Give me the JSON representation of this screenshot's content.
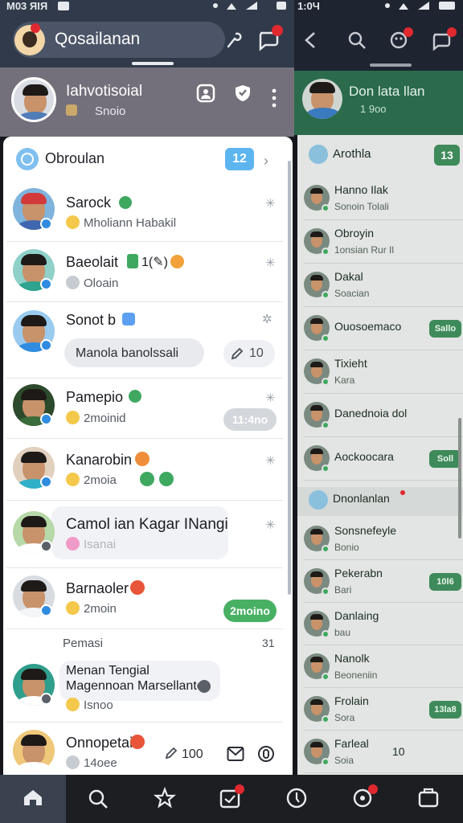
{
  "status_left": {
    "time": "M03 ЯІЯ"
  },
  "status_right": {
    "time": "1:0Ч"
  },
  "left_header": {
    "search_label": "Qosailanan"
  },
  "profile": {
    "name": "Iahvotisoial",
    "status": "Snoio"
  },
  "section": {
    "title": "Obroulan",
    "count": "12"
  },
  "chats": [
    {
      "name": "Sarock",
      "preview": "Mholiann Habakil"
    },
    {
      "name": "Baeolait",
      "name_suffix": "1(✎)",
      "preview": "Oloain"
    },
    {
      "name": "Sonot b",
      "chip": "Manola banolssali",
      "count": "10"
    },
    {
      "name": "Pamepio",
      "preview": "2moinid",
      "badge": "11:4no"
    },
    {
      "name": "Kanarobin",
      "preview": "2moia"
    },
    {
      "name": "Camol ian Kagar INangi",
      "preview": "Isanai"
    },
    {
      "name": "Barnaoler",
      "preview": "2moin",
      "badge": "2moino"
    }
  ],
  "divider": {
    "label": "Pemasi",
    "count": "31"
  },
  "lower_chats": [
    {
      "name": "Menan Tengial",
      "preview": "Magennoan Marsellante",
      "sub": "Isnoo"
    },
    {
      "name": "Onnopetain",
      "sub": "14oee",
      "count": "100"
    }
  ],
  "right_profile": {
    "name": "Don lata llan",
    "sub": "1 9oo"
  },
  "right_section": {
    "title": "Arothla",
    "count": "13"
  },
  "right_rows": [
    {
      "name": "Hanno Ilak",
      "sub": "Sonoin  Tolali"
    },
    {
      "name": "Obroyin",
      "sub": "1onsian  Rur Il"
    },
    {
      "name": "Dakal",
      "sub": "Soacian"
    },
    {
      "name": "Ouosoemaco",
      "badge": "Sallo"
    },
    {
      "name": "Tixieht",
      "sub": "Kara"
    },
    {
      "name": "Danednoia dol",
      "sub": ""
    },
    {
      "name": "Aockoocara",
      "badge": "Soll"
    }
  ],
  "right_section2": {
    "title": "Dnonlanlan"
  },
  "right_rows2": [
    {
      "name": "Sonsnefeyle",
      "sub": "Bonio"
    },
    {
      "name": "Pekerabn",
      "sub": "Bari",
      "badge": "10l6"
    },
    {
      "name": "Danlaing",
      "sub": "bau"
    },
    {
      "name": "Nanolk",
      "sub": "Beoneniin"
    },
    {
      "name": "Frolain",
      "sub": "Sora",
      "badge": "13la8"
    },
    {
      "name": "Farleal",
      "sub": "Soia",
      "count": "10"
    }
  ],
  "colors": {
    "accent_blue": "#2f8ce0",
    "accent_green": "#3fa860",
    "notify_red": "#e0282f"
  }
}
